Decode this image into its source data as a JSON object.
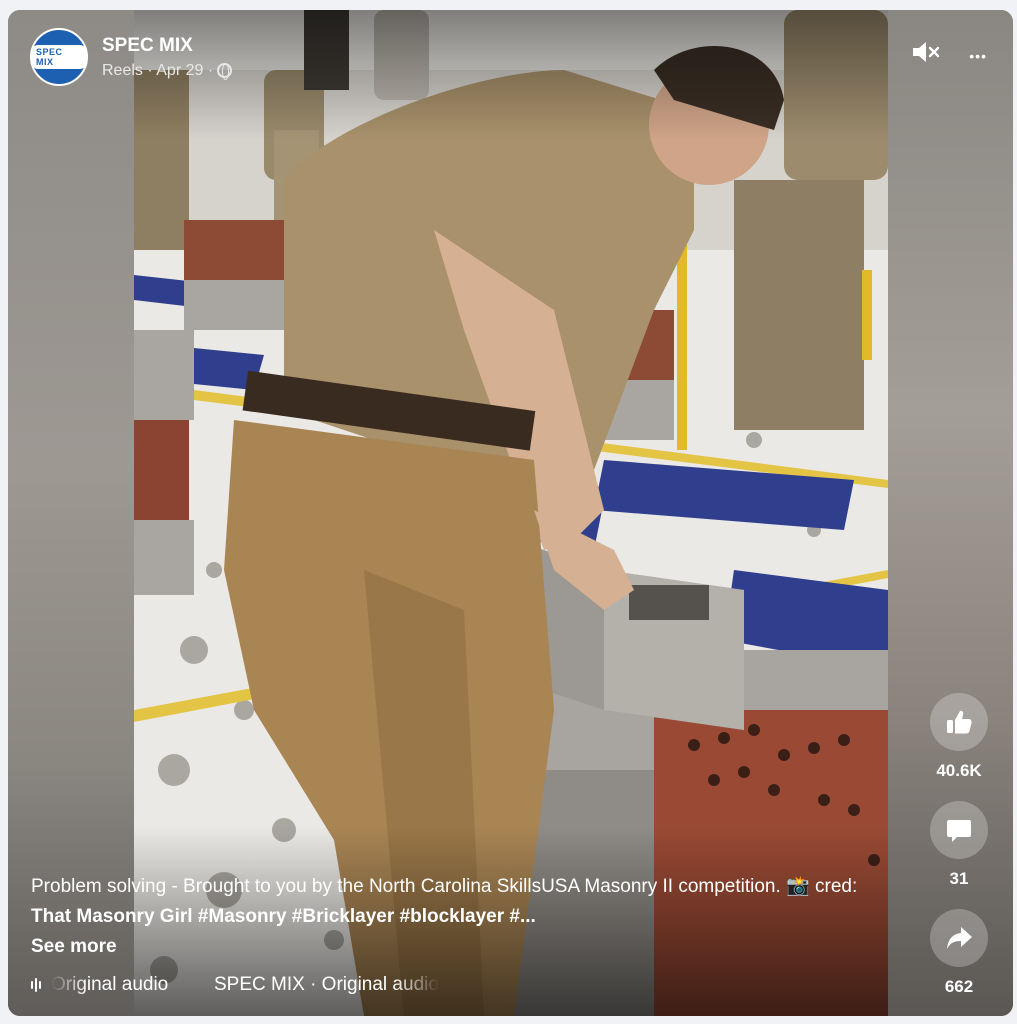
{
  "post": {
    "page_name": "SPEC MIX",
    "avatar_text": "SPEC MIX",
    "meta_prefix": "Reels · Apr 29 ·"
  },
  "controls": {
    "mute_icon": "speaker-muted-icon",
    "more_icon": "more-options-icon",
    "more_glyph": "•••"
  },
  "actions": {
    "like_count": "40.6K",
    "comment_count": "31",
    "share_count": "662"
  },
  "caption": {
    "text": "Problem solving - Brought to you by the North Carolina SkillsUSA Masonry II competition. 📸 cred: ",
    "tags": "That Masonry Girl #Masonry #Bricklayer #blocklayer #...",
    "see_more": "See more"
  },
  "audio": {
    "label_1": "Original audio",
    "label_2": "SPEC MIX · Original audio"
  },
  "colors": {
    "brand_blue": "#1d5fb0",
    "overlay_text": "#ffffff"
  }
}
